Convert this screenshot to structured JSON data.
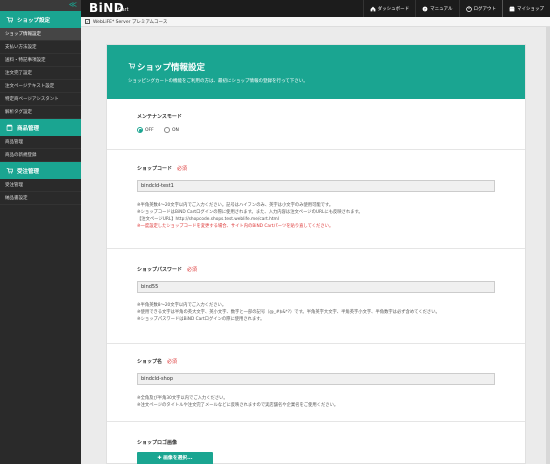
{
  "sidebar": {
    "collapse_glyph": "≪",
    "groups": [
      {
        "label": "ショップ設定",
        "icon": "cart-icon",
        "items": [
          "ショップ情報設定",
          "支払い方法設定",
          "送料・特記事項設定",
          "注文完了設定",
          "注文ページテキスト設定",
          "特定商ページアシスタント",
          "解析タグ設定"
        ]
      },
      {
        "label": "商品管理",
        "icon": "box-icon",
        "items": [
          "商品管理",
          "商品の新規登録"
        ]
      },
      {
        "label": "受注管理",
        "icon": "order-icon",
        "items": [
          "受注管理",
          "納品書設定"
        ]
      }
    ]
  },
  "topbar": {
    "logo": "BiND",
    "logo_sub": "Cart",
    "links": [
      {
        "label": "ダッシュボード",
        "icon": "home-icon"
      },
      {
        "label": "マニュアル",
        "icon": "help-icon"
      },
      {
        "label": "ログアウト",
        "icon": "logout-icon"
      },
      {
        "label": "マイショップ",
        "icon": "shop-icon"
      }
    ]
  },
  "bar2": {
    "checkbox": "✓",
    "label": "WebLiFE* Server プレミアムコース"
  },
  "panel": {
    "title": "ショップ情報設定",
    "desc": "ショッピングカートの機能をご利用の方は、最初にショップ情報の登録を行って下さい。"
  },
  "maintenance": {
    "label": "メンテナンスモード",
    "off": "OFF",
    "on": "ON"
  },
  "required": "必須",
  "shop_code": {
    "label": "ショップコード",
    "value": "bindcld-test1",
    "notes": [
      "※半角英数4～20文字以内でご入力ください。記号はハイフンのみ、英字は小文字のみ使用可能です。",
      "※ショップコードはBiND Cartログインの際に使用されます。また、入力内容は注文ページのURLにも反映されます。",
      "【注文ページURL】http://shopcode.shops.test.weblife.me/cart.html"
    ],
    "warning": "※一度設定したショップコードを変更する場合、サイト内のBiND Cartパーツを貼り直してください。"
  },
  "shop_password": {
    "label": "ショップパスワード",
    "value": "bind55",
    "notes": [
      "※半角英数8～20文字以内でご入力ください。",
      "※使用できる文字は半角の英大文字、英小文字、数字と一部の記号（@_#$&*?）です。半角英字大文字、半角英字小文字、半角数字は必ず含めてください。",
      "※ショップパスワードはBiND Cartログインの際に使用されます。"
    ]
  },
  "shop_name": {
    "label": "ショップ名",
    "value": "bindcld-shop",
    "notes": [
      "※全角及び半角30文字以内でご入力ください。",
      "※注文ページのタイトルや注文完了メールなどに反映されますので実店舗名や企業名をご使用ください。"
    ]
  },
  "shop_logo": {
    "label": "ショップロゴ画像",
    "button": "✚ 画像を選択..."
  }
}
